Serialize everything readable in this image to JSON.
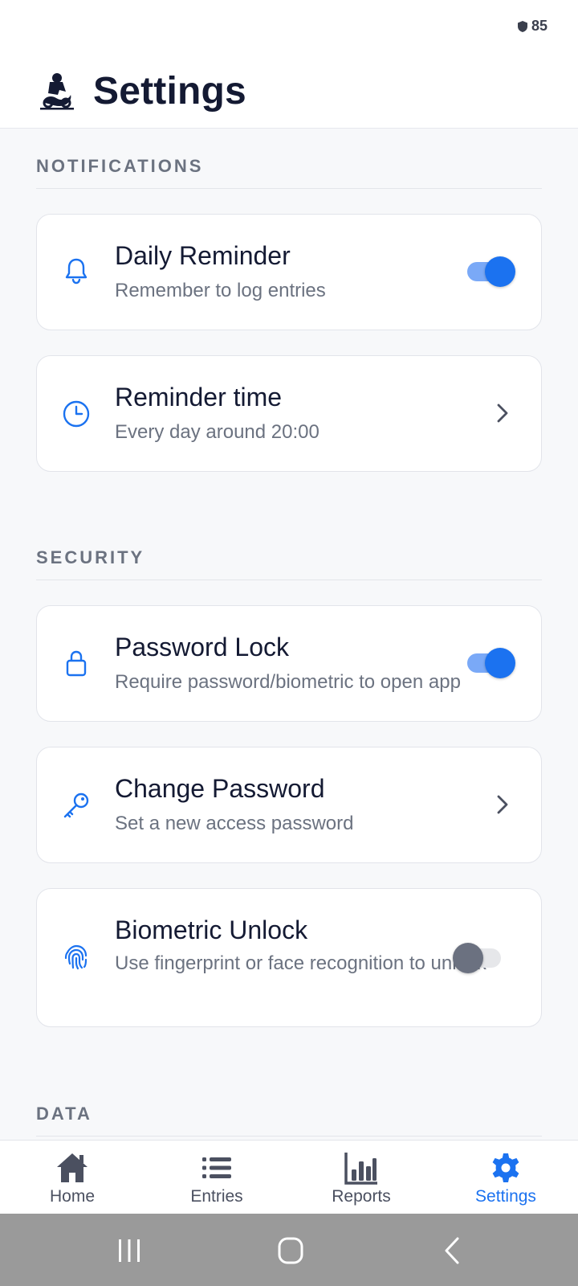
{
  "status_bar": {
    "battery": "85"
  },
  "header": {
    "title": "Settings"
  },
  "sections": {
    "notifications": {
      "label": "NOTIFICATIONS",
      "daily_reminder": {
        "title": "Daily Reminder",
        "subtitle": "Remember to log entries",
        "enabled": true
      },
      "reminder_time": {
        "title": "Reminder time",
        "subtitle": "Every day around 20:00"
      }
    },
    "security": {
      "label": "SECURITY",
      "password_lock": {
        "title": "Password Lock",
        "subtitle": "Require password/biometric to open app",
        "enabled": true
      },
      "change_password": {
        "title": "Change Password",
        "subtitle": "Set a new access password"
      },
      "biometric_unlock": {
        "title": "Biometric Unlock",
        "subtitle": "Use fingerprint or face recognition to unlock",
        "enabled": false
      }
    },
    "data": {
      "label": "DATA"
    }
  },
  "bottom_nav": {
    "home": "Home",
    "entries": "Entries",
    "reports": "Reports",
    "settings": "Settings",
    "active": "settings"
  },
  "colors": {
    "accent": "#1b72f0",
    "text_primary": "#141a33",
    "text_secondary": "#6b7280"
  },
  "icons": {
    "header": "app-logo",
    "notifications": [
      "bell-icon",
      "clock-icon"
    ],
    "security": [
      "lock-icon",
      "key-icon",
      "fingerprint-icon"
    ],
    "nav": [
      "home-icon",
      "list-icon",
      "bar-chart-icon",
      "gear-icon"
    ]
  }
}
